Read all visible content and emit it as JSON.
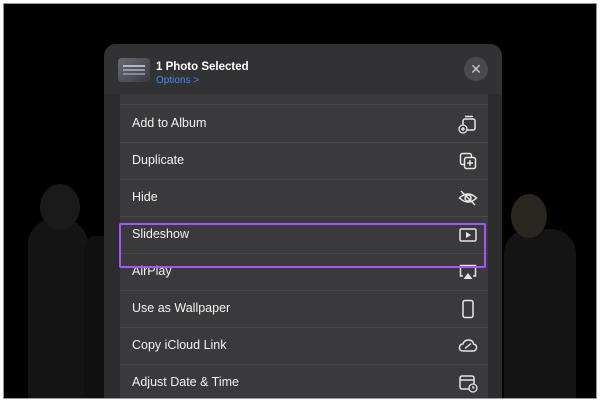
{
  "header": {
    "title": "1 Photo Selected",
    "options_label": "Options >",
    "close_label": "✕"
  },
  "menu": {
    "items": [
      {
        "label": "",
        "icon": "unknown-icon"
      },
      {
        "label": "Add to Album",
        "icon": "add-to-album-icon"
      },
      {
        "label": "Duplicate",
        "icon": "duplicate-icon"
      },
      {
        "label": "Hide",
        "icon": "eye-slash-icon"
      },
      {
        "label": "Slideshow",
        "icon": "play-rectangle-icon"
      },
      {
        "label": "AirPlay",
        "icon": "airplay-icon"
      },
      {
        "label": "Use as Wallpaper",
        "icon": "phone-icon"
      },
      {
        "label": "Copy iCloud Link",
        "icon": "link-cloud-icon"
      },
      {
        "label": "Adjust Date & Time",
        "icon": "calendar-clock-icon"
      }
    ],
    "highlighted_item": "Slideshow"
  },
  "colors": {
    "highlight": "#a855f7",
    "accent": "#3b8ef5"
  }
}
